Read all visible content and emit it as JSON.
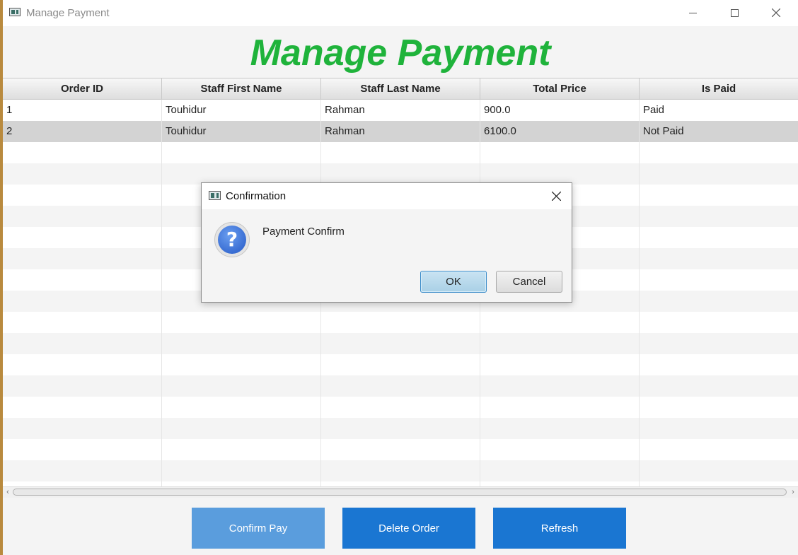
{
  "window": {
    "title": "Manage Payment",
    "controls": {
      "minimize_icon": "minimize-icon",
      "maximize_icon": "maximize-icon",
      "close_icon": "close-icon"
    }
  },
  "heading": "Manage Payment",
  "table": {
    "columns": [
      "Order ID",
      "Staff First Name",
      "Staff Last Name",
      "Total Price",
      "Is Paid"
    ],
    "rows": [
      [
        "1",
        "Touhidur",
        "Rahman",
        "900.0",
        "Paid"
      ],
      [
        "2",
        "Touhidur",
        "Rahman",
        "6100.0",
        "Not Paid"
      ]
    ],
    "selected_row": 2
  },
  "buttons": {
    "confirm_pay": "Confirm Pay",
    "delete_order": "Delete Order",
    "refresh": "Refresh"
  },
  "dialog": {
    "title": "Confirmation",
    "message": "Payment Confirm",
    "icon": "question-icon",
    "ok_label": "OK",
    "cancel_label": "Cancel"
  },
  "colors": {
    "heading": "#1fb33b",
    "button_primary": "#1a76d2",
    "button_disabled": "#5a9ddd",
    "selected_row": "#d3d3d3"
  }
}
